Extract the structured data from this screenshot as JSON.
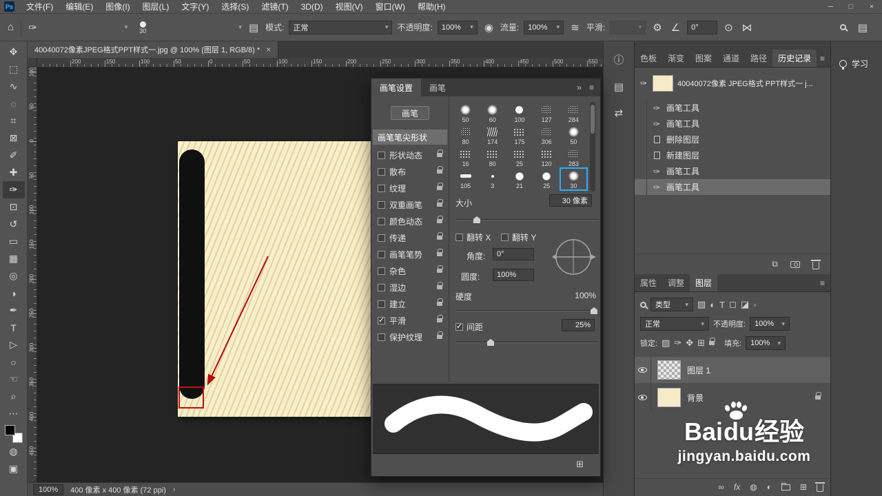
{
  "g": {
    "home": "⌂",
    "caret": "▾",
    "gear": "⚙",
    "angle_icon": "∠",
    "symmetry": "⋈",
    "pressure_opacity": "◉",
    "pressure_size": "⊙",
    "airbrush": "≋",
    "toggle_panel": "▤",
    "collapse": "»",
    "menu": "≡",
    "chev_right": "›",
    "move": "✥",
    "marquee": "⬚",
    "lasso": "∿",
    "quick_select": "◌",
    "crop": "⌗",
    "frame": "⊠",
    "eyedropper": "✐",
    "healing": "✚",
    "brush": "✑",
    "stamp": "⊡",
    "history_brush": "↺",
    "eraser": "▭",
    "gradient": "▦",
    "blur": "◎",
    "dodge": "◑",
    "pen": "✒",
    "type": "T",
    "path_select": "▷",
    "ellipse": "○",
    "hand": "☜",
    "zoom": "⌕",
    "more": "⋯",
    "quick_mask": "◍",
    "screen_mode": "▣",
    "plus_box": "⊞",
    "new_doc": "⧉",
    "info": "ⓘ",
    "notes": "▤",
    "swap": "⇄",
    "img": "▨",
    "adjust": "◐",
    "shape": "◻",
    "smart": "◪",
    "dot": "◦",
    "fx": "fx",
    "link": "∞"
  },
  "window": {
    "logo": "Ps",
    "min": "─",
    "max": "□",
    "close": "×"
  },
  "menubar": {
    "items": [
      "文件(F)",
      "编辑(E)",
      "图像(I)",
      "图层(L)",
      "文字(Y)",
      "选择(S)",
      "滤镜(T)",
      "3D(D)",
      "视图(V)",
      "窗口(W)",
      "帮助(H)"
    ]
  },
  "options": {
    "brush_size": "30",
    "mode_label": "模式:",
    "mode_value": "正常",
    "opacity_label": "不透明度:",
    "opacity_value": "100%",
    "flow_label": "流量:",
    "flow_value": "100%",
    "smooth_label": "平滑:",
    "angle_value": "0°"
  },
  "doc_tab": {
    "title": "40040072像素JPEG格式PPT样式一.jpg @ 100% (图层 1, RGB/8) *",
    "close": "×"
  },
  "rulers": {
    "h": [
      "200",
      "150",
      "100",
      "50",
      "0",
      "50",
      "100",
      "150",
      "200",
      "250",
      "300",
      "350",
      "400",
      "450",
      "500",
      "550"
    ],
    "v": [
      "100",
      "50",
      "0",
      "50",
      "100",
      "150",
      "200",
      "250",
      "300",
      "350",
      "400",
      "450"
    ]
  },
  "brush_panel": {
    "tab_settings": "画笔设置",
    "tab_brushes": "画笔",
    "brushes_button": "画笔",
    "tip_shape": "画笔笔尖形状",
    "options": [
      {
        "label": "形状动态",
        "checked": false
      },
      {
        "label": "散布",
        "checked": false
      },
      {
        "label": "纹理",
        "checked": false
      },
      {
        "label": "双重画笔",
        "checked": false
      },
      {
        "label": "颜色动态",
        "checked": false
      },
      {
        "label": "传递",
        "checked": false
      },
      {
        "label": "画笔笔势",
        "checked": false
      },
      {
        "label": "杂色",
        "checked": false
      },
      {
        "label": "湿边",
        "checked": false
      },
      {
        "label": "建立",
        "checked": false
      },
      {
        "label": "平滑",
        "checked": true
      },
      {
        "label": "保护纹理",
        "checked": false
      }
    ],
    "presets": [
      {
        "label": "50"
      },
      {
        "label": "60"
      },
      {
        "label": "100"
      },
      {
        "label": "127"
      },
      {
        "label": "284"
      },
      {
        "label": "80"
      },
      {
        "label": "174"
      },
      {
        "label": "175"
      },
      {
        "label": "306"
      },
      {
        "label": "50"
      },
      {
        "label": "16"
      },
      {
        "label": "80"
      },
      {
        "label": "25"
      },
      {
        "label": "120"
      },
      {
        "label": "283"
      },
      {
        "label": "105"
      },
      {
        "label": "3"
      },
      {
        "label": "21"
      },
      {
        "label": "25"
      },
      {
        "label": "30",
        "selected": true
      }
    ],
    "size_label": "大小",
    "size_value": "30 像素",
    "flip_x": "翻转 X",
    "flip_y": "翻转 Y",
    "angle_label": "角度:",
    "angle_value": "0°",
    "roundness_label": "圆度:",
    "roundness_value": "100%",
    "hardness_label": "硬度",
    "hardness_value": "100%",
    "spacing_label": "间距",
    "spacing_value": "25%",
    "spacing_checked": true
  },
  "right": {
    "tabs1": [
      "色板",
      "渐变",
      "图案",
      "通道",
      "路径",
      "历史记录"
    ],
    "history": {
      "snapshot": "40040072像素 JPEG格式 PPT样式一  j...",
      "steps": [
        {
          "label": "画笔工具",
          "icon": "brush"
        },
        {
          "label": "画笔工具",
          "icon": "brush"
        },
        {
          "label": "删除图层",
          "icon": "page"
        },
        {
          "label": "新建图层",
          "icon": "page"
        },
        {
          "label": "画笔工具",
          "icon": "brush"
        },
        {
          "label": "画笔工具",
          "icon": "brush",
          "selected": true
        }
      ]
    },
    "tabs2": [
      "属性",
      "调整",
      "图层"
    ],
    "layers": {
      "filter_label": "类型",
      "blend_value": "正常",
      "opacity_label": "不透明度:",
      "opacity_value": "100%",
      "lock_label": "锁定:",
      "fill_label": "填充:",
      "fill_value": "100%",
      "rows": [
        {
          "name": "图层 1",
          "selected": true
        },
        {
          "name": "背景",
          "locked": true
        }
      ]
    }
  },
  "learn": {
    "label": "学习"
  },
  "status": {
    "zoom": "100%",
    "info": "400 像素 x 400 像素 (72 ppi)"
  },
  "watermark": {
    "bai": "Bai",
    "du": "du",
    "jingyan": "经验",
    "url": "jingyan.baidu.com"
  }
}
